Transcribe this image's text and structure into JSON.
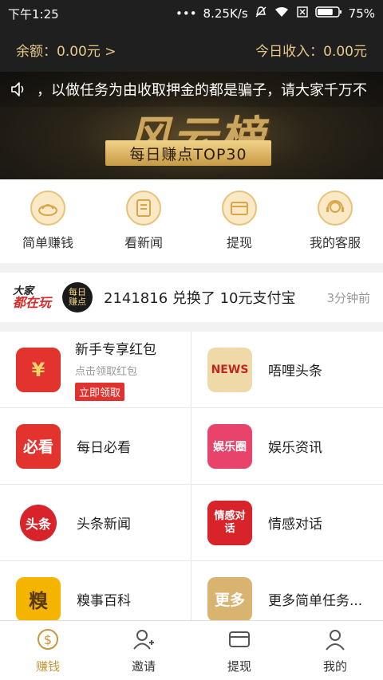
{
  "status_bar": {
    "time": "下午1:25",
    "network_speed": "8.25K/s",
    "battery_percent": "75%",
    "battery_level": 0.75
  },
  "balance": {
    "left_label": "余额：0.00元 >",
    "right_label": "今日收入：0.00元"
  },
  "banner": {
    "marquee_text": "，以做任务为由收取押金的都是骗子，请大家千万不",
    "title": "风云榜",
    "subtitle": "每日赚点TOP30"
  },
  "quick_actions": [
    {
      "label": "简单赚钱",
      "icon": "money-bag-icon"
    },
    {
      "label": "看新闻",
      "icon": "news-doc-icon"
    },
    {
      "label": "提现",
      "icon": "wallet-icon"
    },
    {
      "label": "我的客服",
      "icon": "customer-service-icon"
    }
  ],
  "ticker": {
    "logo_dajia_top": "大家",
    "logo_dajia_bottom": "都在玩",
    "logo_meiri_top": "每日",
    "logo_meiri_bottom": "赚点",
    "text": "2141816 兑换了 10元支付宝",
    "time": "3分钟前"
  },
  "tasks": {
    "newbie": {
      "title": "新手专享红包",
      "subtitle": "点击领取红包",
      "button": "立即领取",
      "icon_text": "¥"
    },
    "items": [
      {
        "label": "唔哩头条",
        "icon_text": "NEWS",
        "color": "#f0d9a8"
      },
      {
        "label": "每日必看",
        "icon_text": "必看",
        "color": "#e2332f"
      },
      {
        "label": "娱乐资讯",
        "icon_text": "娱乐圈",
        "color": "#e8436a"
      },
      {
        "label": "头条新闻",
        "icon_text": "头条",
        "color": "#ffffff"
      },
      {
        "label": "情感对话",
        "icon_text": "情感对话",
        "color": "#d8232a"
      },
      {
        "label": "糗事百科",
        "icon_text": "糗",
        "color": "#f5b400"
      },
      {
        "label": "更多简单任务...",
        "icon_text": "更多",
        "color": "#d9b370"
      }
    ]
  },
  "bottom_nav": [
    {
      "label": "赚钱",
      "icon": "coin-icon",
      "active": true
    },
    {
      "label": "邀请",
      "icon": "add-user-icon",
      "active": false
    },
    {
      "label": "提现",
      "icon": "wallet-icon",
      "active": false
    },
    {
      "label": "我的",
      "icon": "profile-icon",
      "active": false
    }
  ],
  "colors": {
    "header_bg": "#1f1f1f",
    "gold_text": "#e8c98a",
    "active_nav": "#c9973a",
    "red_button": "#e0332f"
  }
}
